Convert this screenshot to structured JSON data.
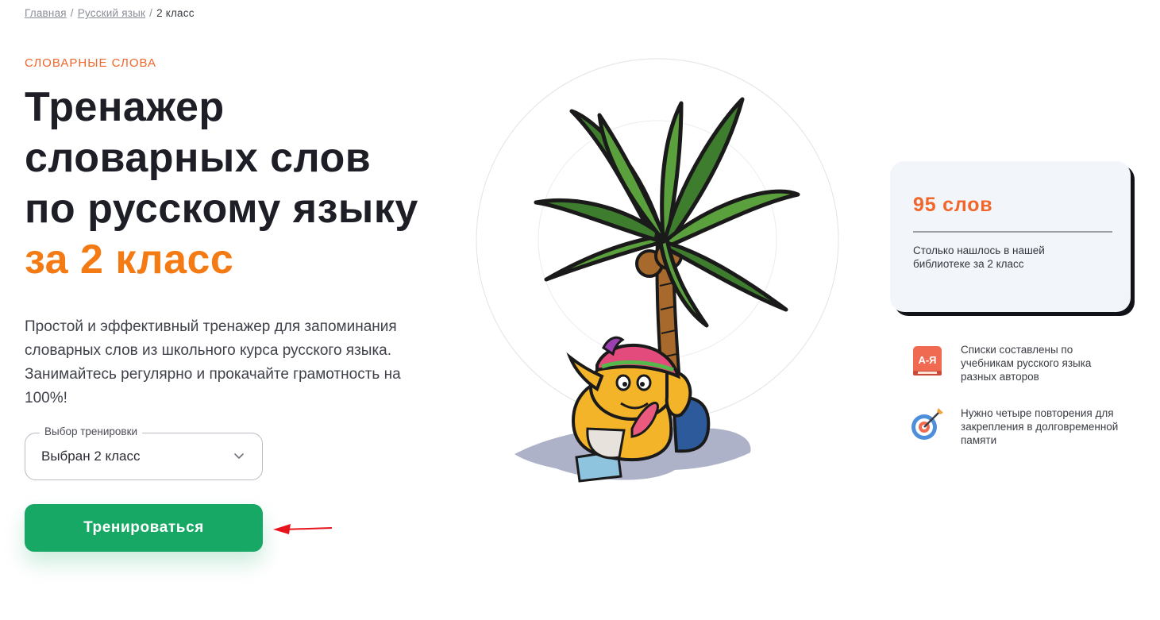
{
  "breadcrumb": {
    "items": [
      {
        "label": "Главная"
      },
      {
        "label": "Русский язык"
      }
    ],
    "separator": "/",
    "current": "2 класс"
  },
  "hero": {
    "eyebrow": "СЛОВАРНЫЕ СЛОВА",
    "title_lines": [
      "Тренажер",
      "словарных слов",
      "по русскому языку"
    ],
    "title_accent": "за 2 класс",
    "description": "Простой и эффективный тренажер для запоминания словарных слов из школьного курса русского языка. Занимайтесь регулярно и прокачайте грамотность на 100%!"
  },
  "training_select": {
    "legend": "Выбор тренировки",
    "value": "Выбран 2 класс",
    "icon": "chevron-down-icon"
  },
  "train_button": {
    "label": "Тренироваться"
  },
  "stats_card": {
    "count": "95 слов",
    "note": "Столько нашлось в нашей библиотеке за 2 класс"
  },
  "features": [
    {
      "icon": "dictionary-book-icon",
      "icon_text": "А-Я",
      "text": "Списки составлены по учебникам русского языка разных авторов"
    },
    {
      "icon": "target-icon",
      "text": "Нужно четыре повторения для закрепления в долговременной памяти"
    }
  ],
  "colors": {
    "accent_orange": "#f47a14",
    "eyebrow_orange": "#f0662b",
    "button_green": "#17a865",
    "card_bg": "#f2f6fb",
    "arrow_red": "#e8141c"
  }
}
